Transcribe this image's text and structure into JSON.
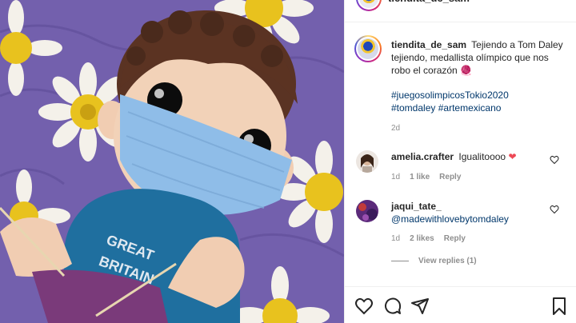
{
  "header": {
    "username": "tiendita_de_sam"
  },
  "caption": {
    "username": "tiendita_de_sam",
    "text": "Tejiendo a Tom Daley tejiendo, medallista olímpico que nos robo el corazón 🧶",
    "hashtags": [
      "#juegosolimpicosTokio2020",
      "#tomdaley",
      "#artemexicano"
    ],
    "time": "2d"
  },
  "comments": [
    {
      "username": "amelia.crafter",
      "text": "Igualitoooo",
      "emoji": "❤",
      "time": "1d",
      "likes": "1 like",
      "reply": "Reply"
    },
    {
      "username": "jaqui_tate_",
      "mention": "@madewithlovebytomdaley",
      "time": "1d",
      "likes": "2 likes",
      "reply": "Reply",
      "view_replies": "View replies (1)"
    }
  ],
  "colors": {
    "link": "#00376b",
    "meta": "#8e8e8e",
    "heart": "#ed4956"
  },
  "icons": [
    "like-icon",
    "comment-icon",
    "share-icon",
    "save-icon"
  ]
}
